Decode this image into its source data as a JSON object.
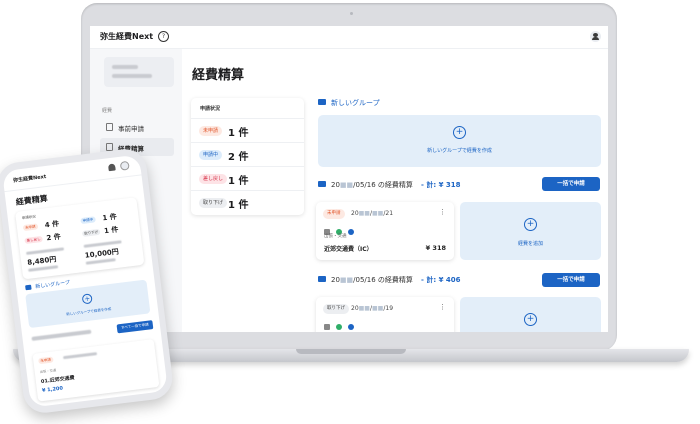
{
  "desktop": {
    "app_name": "弥生経費Next",
    "help_symbol": "?",
    "icons": {
      "help": "question-circle-icon",
      "user": "account-icon"
    },
    "sidebar": {
      "section_caption": "経費",
      "items": [
        {
          "label": "事前申請",
          "icon": "document-icon",
          "active": false
        },
        {
          "label": "経費精算",
          "icon": "document-icon",
          "active": true
        }
      ]
    },
    "page_title": "経費精算",
    "status_card": {
      "title": "申請状況",
      "rows": [
        {
          "badge": "未申請",
          "count": "1 件",
          "badge_bg": "#fde9e2",
          "badge_fg": "#e2572c"
        },
        {
          "badge": "申請中",
          "count": "2 件",
          "badge_bg": "#dcecfb",
          "badge_fg": "#1c64c4"
        },
        {
          "badge": "差し戻し",
          "count": "1 件",
          "badge_bg": "#fde3e6",
          "badge_fg": "#d63046"
        },
        {
          "badge": "取り下げ",
          "count": "1 件",
          "badge_bg": "#eceef1",
          "badge_fg": "#444444"
        }
      ]
    },
    "new_group": {
      "header": "新しいグループ",
      "plus": "+",
      "label": "新しいグループで経費を作成"
    },
    "groups": [
      {
        "title_prefix": "20",
        "title_suffix": "/05/16 の経費精算",
        "sum": "- 計: ¥ 318",
        "bulk_button": "一括で申請",
        "card": {
          "status": "未申請",
          "status_bg": "#fde9e2",
          "status_fg": "#e2572c",
          "date_prefix": "20",
          "date_suffix": "/21",
          "kebab": "⋮",
          "category": "出張・交通",
          "name": "近郊交通費（IC）",
          "amount": "¥ 318"
        },
        "add_label": "経費を追加",
        "plus": "+"
      },
      {
        "title_prefix": "20",
        "title_suffix": "/05/16 の経費精算",
        "sum": "- 計: ¥ 406",
        "bulk_button": "一括で申請",
        "card": {
          "status": "取り下げ",
          "status_bg": "#eceef1",
          "status_fg": "#444444",
          "date_prefix": "20",
          "date_suffix": "/19",
          "kebab": "⋮"
        },
        "plus": "+"
      }
    ],
    "colors": {
      "accent": "#1c64c4",
      "accent_light": "#e3eef9",
      "sidebar_bg": "#f6f7f9"
    }
  },
  "mobile": {
    "app_name": "弥生経費Next",
    "page_title": "経費精算",
    "status_caption": "申請状況",
    "rows": [
      {
        "badge": "未申請",
        "count": "4 件",
        "badge_bg": "#fde9e2",
        "badge_fg": "#e2572c"
      },
      {
        "badge": "申請中",
        "count": "1 件",
        "badge_bg": "#dcecfb",
        "badge_fg": "#1c64c4"
      },
      {
        "badge": "差し戻し",
        "count": "2 件",
        "badge_bg": "#fde3e6",
        "badge_fg": "#d63046"
      },
      {
        "badge": "取り下げ",
        "count": "1 件",
        "badge_bg": "#eceef1",
        "badge_fg": "#444444"
      }
    ],
    "amount_left": "8,480円",
    "amount_right": "10,000円",
    "new_group_header": "新しいグループ",
    "new_group_label": "新しいグループで経費を作成",
    "bulk_button": "すべて一括で申請",
    "card": {
      "status": "未申請",
      "category": "出張・交通",
      "name": "01.近郊交通費",
      "amount": "¥ 1,200"
    }
  }
}
